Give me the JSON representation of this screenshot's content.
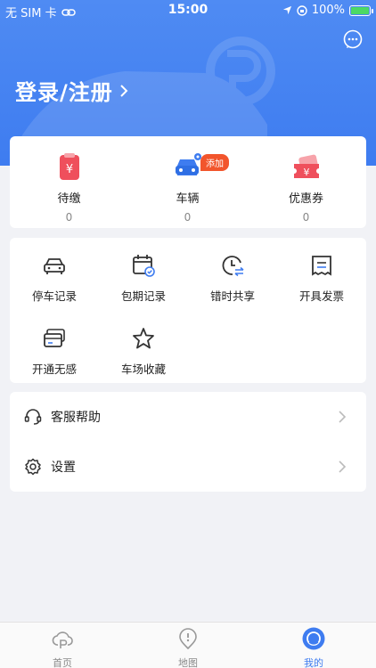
{
  "status_bar": {
    "carrier": "无 SIM 卡",
    "time": "15:00",
    "battery": "100%"
  },
  "header": {
    "login_label": "登录/注册"
  },
  "stats": [
    {
      "label": "待缴",
      "count": "0"
    },
    {
      "label": "车辆",
      "count": "0",
      "badge": "添加"
    },
    {
      "label": "优惠券",
      "count": "0"
    }
  ],
  "services": [
    {
      "label": "停车记录"
    },
    {
      "label": "包期记录"
    },
    {
      "label": "错时共享"
    },
    {
      "label": "开具发票"
    },
    {
      "label": "开通无感"
    },
    {
      "label": "车场收藏"
    }
  ],
  "menu": [
    {
      "label": "客服帮助"
    },
    {
      "label": "设置"
    }
  ],
  "tabbar": [
    {
      "label": "首页"
    },
    {
      "label": "地图"
    },
    {
      "label": "我的"
    }
  ],
  "colors": {
    "primary": "#3e7cf0",
    "badge": "#f2552c",
    "stat_icon_red": "#ef4f5c"
  }
}
